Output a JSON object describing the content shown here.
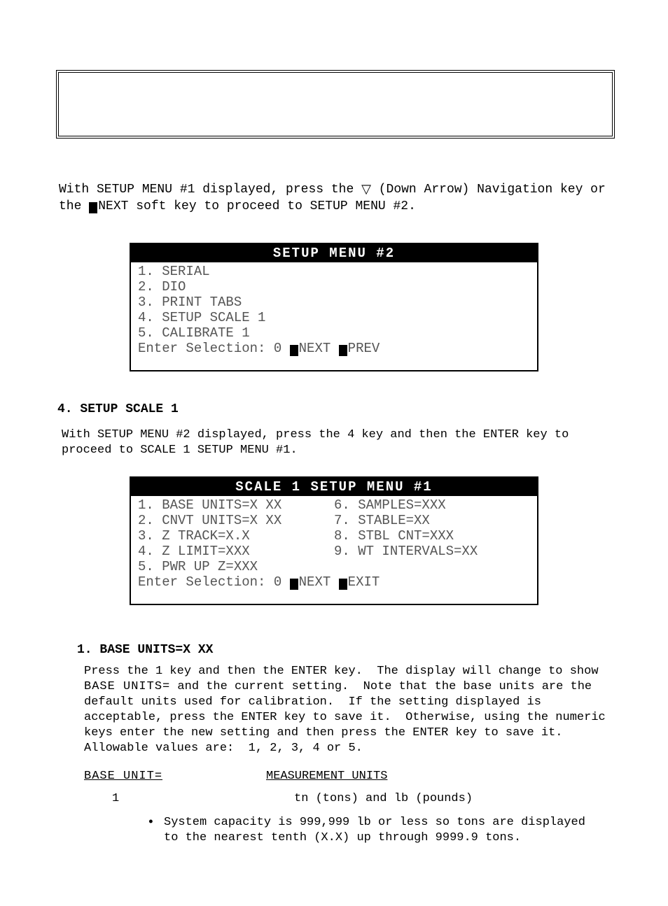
{
  "intro_line1": "With SETUP MENU #1 displayed, press the ",
  "intro_line2_a": " (Down Arrow) Navigation key or the ",
  "intro_line2_b": " soft key to proceed to SETUP MENU #2.",
  "nav_next_label": "NEXT",
  "nav_prev_label": "PREV",
  "nav_exit_label": "EXIT",
  "enter_selection_label": "Enter Selection:",
  "enter_selection_value": "0",
  "setup_menu2": {
    "title": "SETUP MENU #2",
    "items": [
      "1. SERIAL",
      "2. DIO",
      "3. PRINT TABS",
      "4. SETUP SCALE 1",
      "5. CALIBRATE 1"
    ]
  },
  "section_heading": "4. SETUP SCALE 1",
  "section_text": "With SETUP MENU #2 displayed, press the 4 key and then the ENTER key to proceed to SCALE 1 SETUP MENU #1.",
  "scale1_menu": {
    "title": "SCALE 1 SETUP MENU #1",
    "left": [
      "1. BASE UNITS=X XX",
      "2. CNVT UNITS=X XX",
      "3. Z TRACK=X.X",
      "4. Z LIMIT=XXX",
      "5. PWR UP Z=XXX"
    ],
    "right": [
      "6. SAMPLES=XXX",
      "7. STABLE=XX",
      "8. STBL CNT=XXX",
      "9. WT INTERVALS=XX"
    ]
  },
  "item_heading": "1. BASE UNITS=X XX",
  "item_text_1a": "Press the 1 key and then the ENTER key.  The display will change to show ",
  "item_text_1b": "BASE UNITS=",
  "item_text_1c": " and the current setting.  Note that the base units are the default units used for calibration.  If the setting displayed is acceptable, press the ENTER key to save it.  Otherwise, using the numeric keys enter the new setting and then press the ENTER key to save it.  Allowable values are:  1, 2, 3, 4 or 5.",
  "table_hdr_left": "BASE UNIT=",
  "table_hdr_right": "MEASUREMENT UNITS",
  "row1_left": "1",
  "row1_right": "tn (tons) and lb (pounds)",
  "bullet_text": "System capacity is 999,999 lb or less so tons are displayed to the nearest tenth (X.X) up through 9999.9 tons."
}
